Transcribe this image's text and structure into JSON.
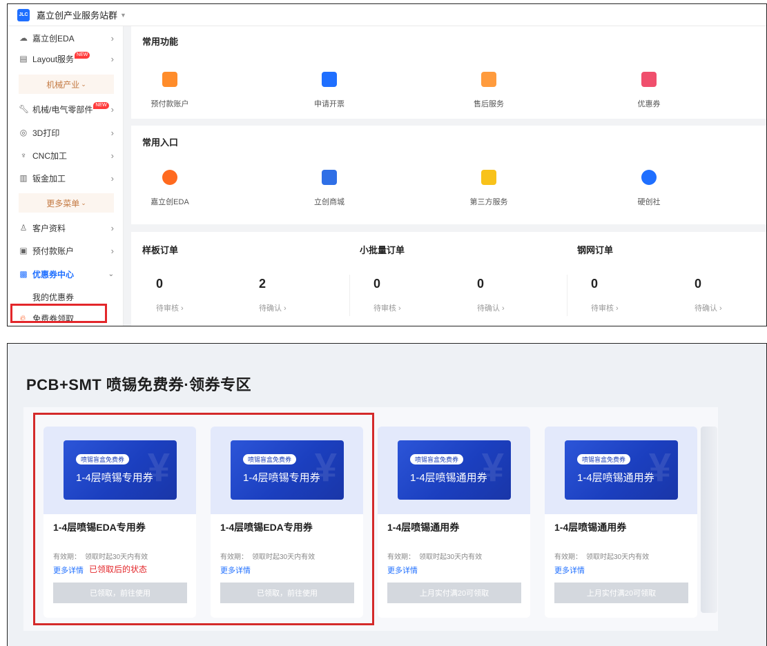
{
  "top": {
    "app_title": "嘉立创产业服务站群",
    "sidebar": {
      "items": [
        {
          "icon": "cloud-icon",
          "label": "嘉立创EDA"
        },
        {
          "icon": "layout-icon",
          "label": "Layout服务",
          "badge": "NEW"
        },
        {
          "icon": "wrench-icon",
          "label": "机械/电气零部件",
          "badge": "NEW"
        },
        {
          "icon": "printer3d-icon",
          "label": "3D打印"
        },
        {
          "icon": "cnc-icon",
          "label": "CNC加工"
        },
        {
          "icon": "sheet-metal-icon",
          "label": "钣金加工"
        },
        {
          "icon": "user-icon",
          "label": "客户资料"
        },
        {
          "icon": "wallet-icon",
          "label": "预付款账户"
        },
        {
          "icon": "coupon-icon",
          "label": "优惠券中心"
        }
      ],
      "group_mech": "机械产业",
      "group_more": "更多菜单",
      "sub_my_coupons": "我的优惠券",
      "sub_free_coupon": "免费券领取"
    },
    "common_functions": {
      "title": "常用功能",
      "items": [
        "预付款账户",
        "申请开票",
        "售后服务",
        "优惠券"
      ]
    },
    "common_entries": {
      "title": "常用入口",
      "items": [
        "嘉立创EDA",
        "立创商城",
        "第三方服务",
        "硬创社"
      ]
    },
    "orders": [
      {
        "title": "样板订单",
        "pending_review": "0",
        "pending_confirm": "2"
      },
      {
        "title": "小批量订单",
        "pending_review": "0",
        "pending_confirm": "0"
      },
      {
        "title": "钢网订单",
        "pending_review": "0",
        "pending_confirm": "0"
      }
    ],
    "order_labels": {
      "review": "待审核 ›",
      "confirm": "待确认 ›"
    }
  },
  "bottom": {
    "title": "PCB+SMT 喷锡免费券·领券专区",
    "cards": [
      {
        "tag": "喷锡盲盒免费券",
        "ticket": "1-4层喷锡专用券",
        "name": "1-4层喷锡EDA专用券",
        "validity_label": "有效期：",
        "validity": "领取时起30天内有效",
        "more": "更多详情",
        "button": "已领取，前往使用"
      },
      {
        "tag": "喷锡盲盒免费券",
        "ticket": "1-4层喷锡专用券",
        "name": "1-4层喷锡EDA专用券",
        "validity_label": "有效期：",
        "validity": "领取时起30天内有效",
        "more": "更多详情",
        "button": "已领取，前往使用"
      },
      {
        "tag": "喷锡盲盒免费券",
        "ticket": "1-4层喷锡通用券",
        "name": "1-4层喷锡通用券",
        "validity_label": "有效期：",
        "validity": "领取时起30天内有效",
        "more": "更多详情",
        "button": "上月实付满20可领取"
      },
      {
        "tag": "喷锡盲盒免费券",
        "ticket": "1-4层喷锡通用券",
        "name": "1-4层喷锡通用券",
        "validity_label": "有效期：",
        "validity": "领取时起30天内有效",
        "more": "更多详情",
        "button": "上月实付满20可领取"
      }
    ],
    "annotation": "已领取后的状态"
  },
  "colors": {
    "accent": "#1f6fff",
    "highlight": "#e3262a",
    "ticket": "#1b3fbf"
  }
}
